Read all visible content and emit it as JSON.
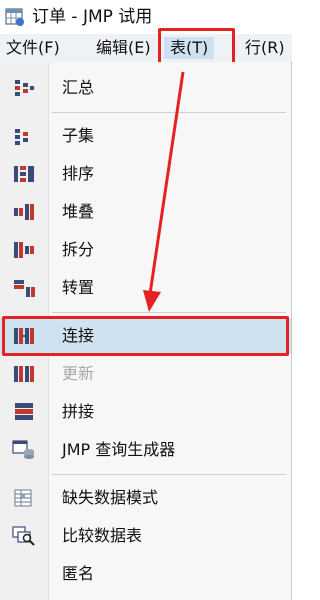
{
  "window": {
    "title": "订单 - JMP 试用"
  },
  "menubar": {
    "items": [
      "文件(F)",
      "编辑(E)",
      "表(T)",
      "行(R)"
    ]
  },
  "menu": {
    "items": [
      {
        "label": "汇总",
        "icon": "summary-icon",
        "enabled": true
      },
      {
        "label": "子集",
        "icon": "subset-icon",
        "enabled": true
      },
      {
        "label": "排序",
        "icon": "sort-icon",
        "enabled": true
      },
      {
        "label": "堆叠",
        "icon": "stack-icon",
        "enabled": true
      },
      {
        "label": "拆分",
        "icon": "split-icon",
        "enabled": true
      },
      {
        "label": "转置",
        "icon": "transpose-icon",
        "enabled": true
      },
      {
        "label": "连接",
        "icon": "join-icon",
        "enabled": true,
        "selected": true
      },
      {
        "label": "更新",
        "icon": "update-icon",
        "enabled": false
      },
      {
        "label": "拼接",
        "icon": "concatenate-icon",
        "enabled": true
      },
      {
        "label": "JMP 查询生成器",
        "icon": "query-builder-icon",
        "enabled": true
      },
      {
        "label": "缺失数据模式",
        "icon": "missing-data-pattern-icon",
        "enabled": true
      },
      {
        "label": "比较数据表",
        "icon": "compare-tables-icon",
        "enabled": true
      },
      {
        "label": "匿名",
        "icon": "anonymize-icon",
        "enabled": true
      }
    ]
  },
  "colors": {
    "highlight_box": "#e52222",
    "selection_bg": "#cfe2f0",
    "disabled_text": "#a8a8a8"
  }
}
